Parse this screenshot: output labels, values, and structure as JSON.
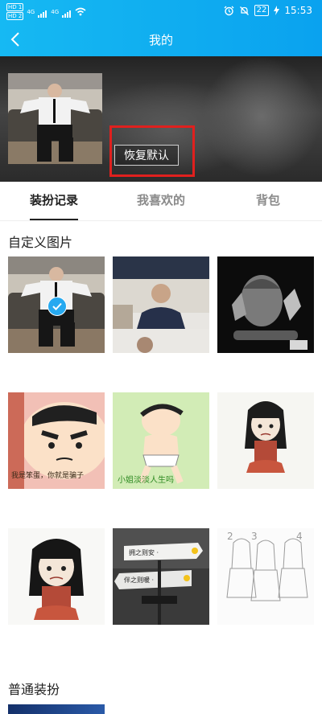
{
  "status_bar": {
    "hd1": "HD 1",
    "hd2": "HD 2",
    "net1": "4G",
    "net2": "4G",
    "battery": "22",
    "time": "15:53"
  },
  "header": {
    "title": "我的"
  },
  "banner": {
    "restore_label": "恢复默认"
  },
  "tabs": [
    {
      "label": "装扮记录",
      "active": true
    },
    {
      "label": "我喜欢的",
      "active": false
    },
    {
      "label": "背包",
      "active": false
    }
  ],
  "sections": {
    "custom_images": "自定义图片",
    "normal_dress": "普通装扮"
  },
  "tile_captions": {
    "shinchan1": "我是笨蛋，你就是骗子",
    "shinchan2": "小姐淡淡人生吗",
    "sign1": "拥之则安 ·",
    "sign2": "伴之则暖 ·"
  },
  "colors": {
    "accent": "#10aef0",
    "highlight_box": "#e0201e",
    "check": "#26a9f0"
  }
}
